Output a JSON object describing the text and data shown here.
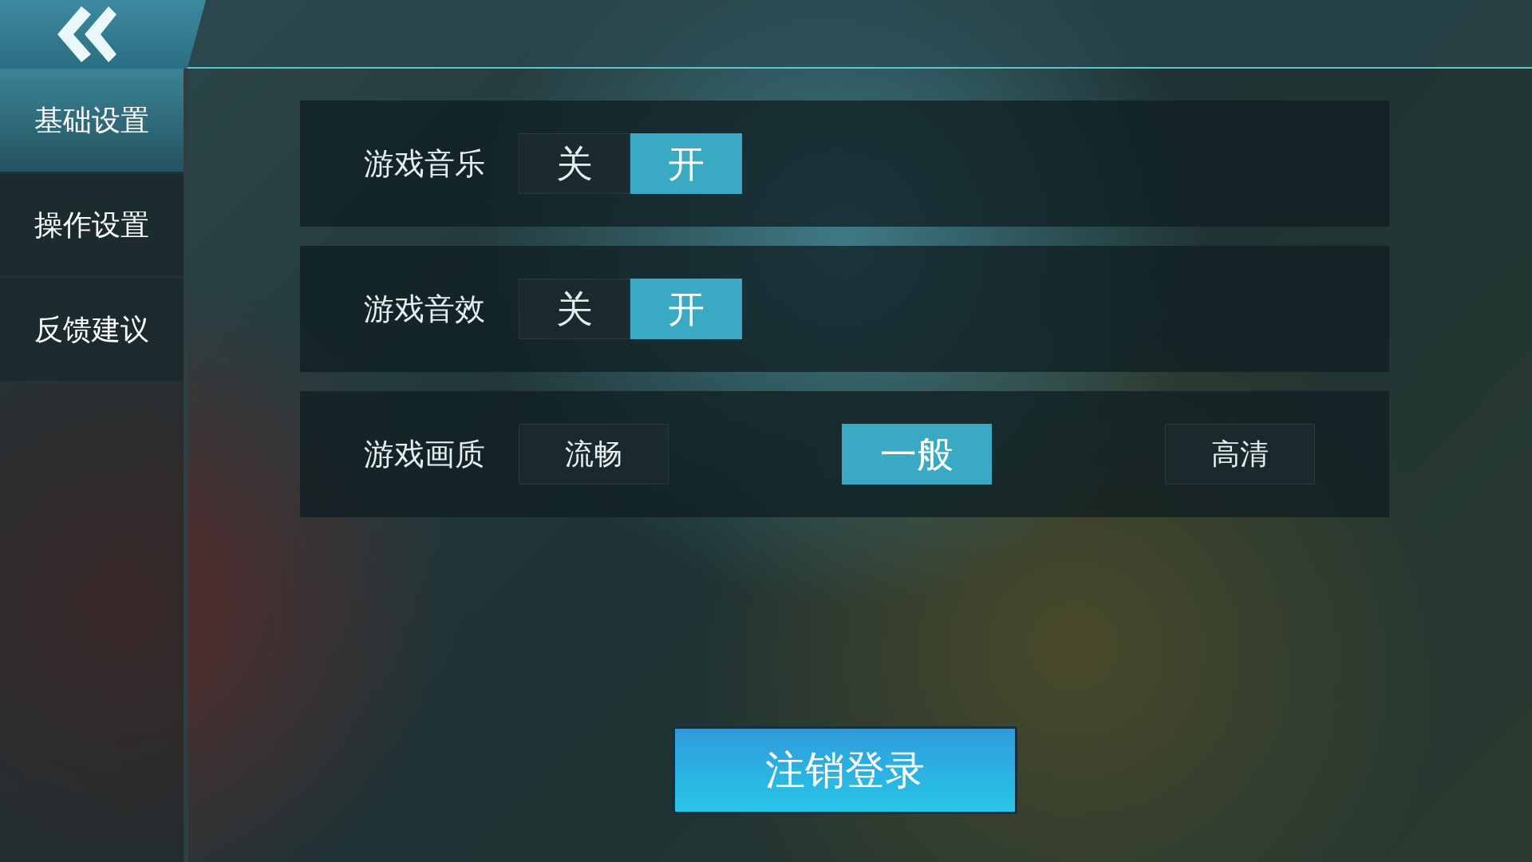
{
  "sidebar": {
    "items": [
      {
        "label": "基础设置",
        "selected": true
      },
      {
        "label": "操作设置",
        "selected": false
      },
      {
        "label": "反馈建议",
        "selected": false
      }
    ]
  },
  "settings": [
    {
      "label": "游戏音乐",
      "kind": "toggle",
      "options": [
        {
          "label": "关",
          "selected": false
        },
        {
          "label": "开",
          "selected": true
        }
      ]
    },
    {
      "label": "游戏音效",
      "kind": "toggle",
      "options": [
        {
          "label": "关",
          "selected": false
        },
        {
          "label": "开",
          "selected": true
        }
      ]
    },
    {
      "label": "游戏画质",
      "kind": "choice",
      "options": [
        {
          "label": "流畅",
          "selected": false
        },
        {
          "label": "一般",
          "selected": true
        },
        {
          "label": "高清",
          "selected": false
        }
      ]
    }
  ],
  "logout_button": {
    "label": "注销登录"
  }
}
